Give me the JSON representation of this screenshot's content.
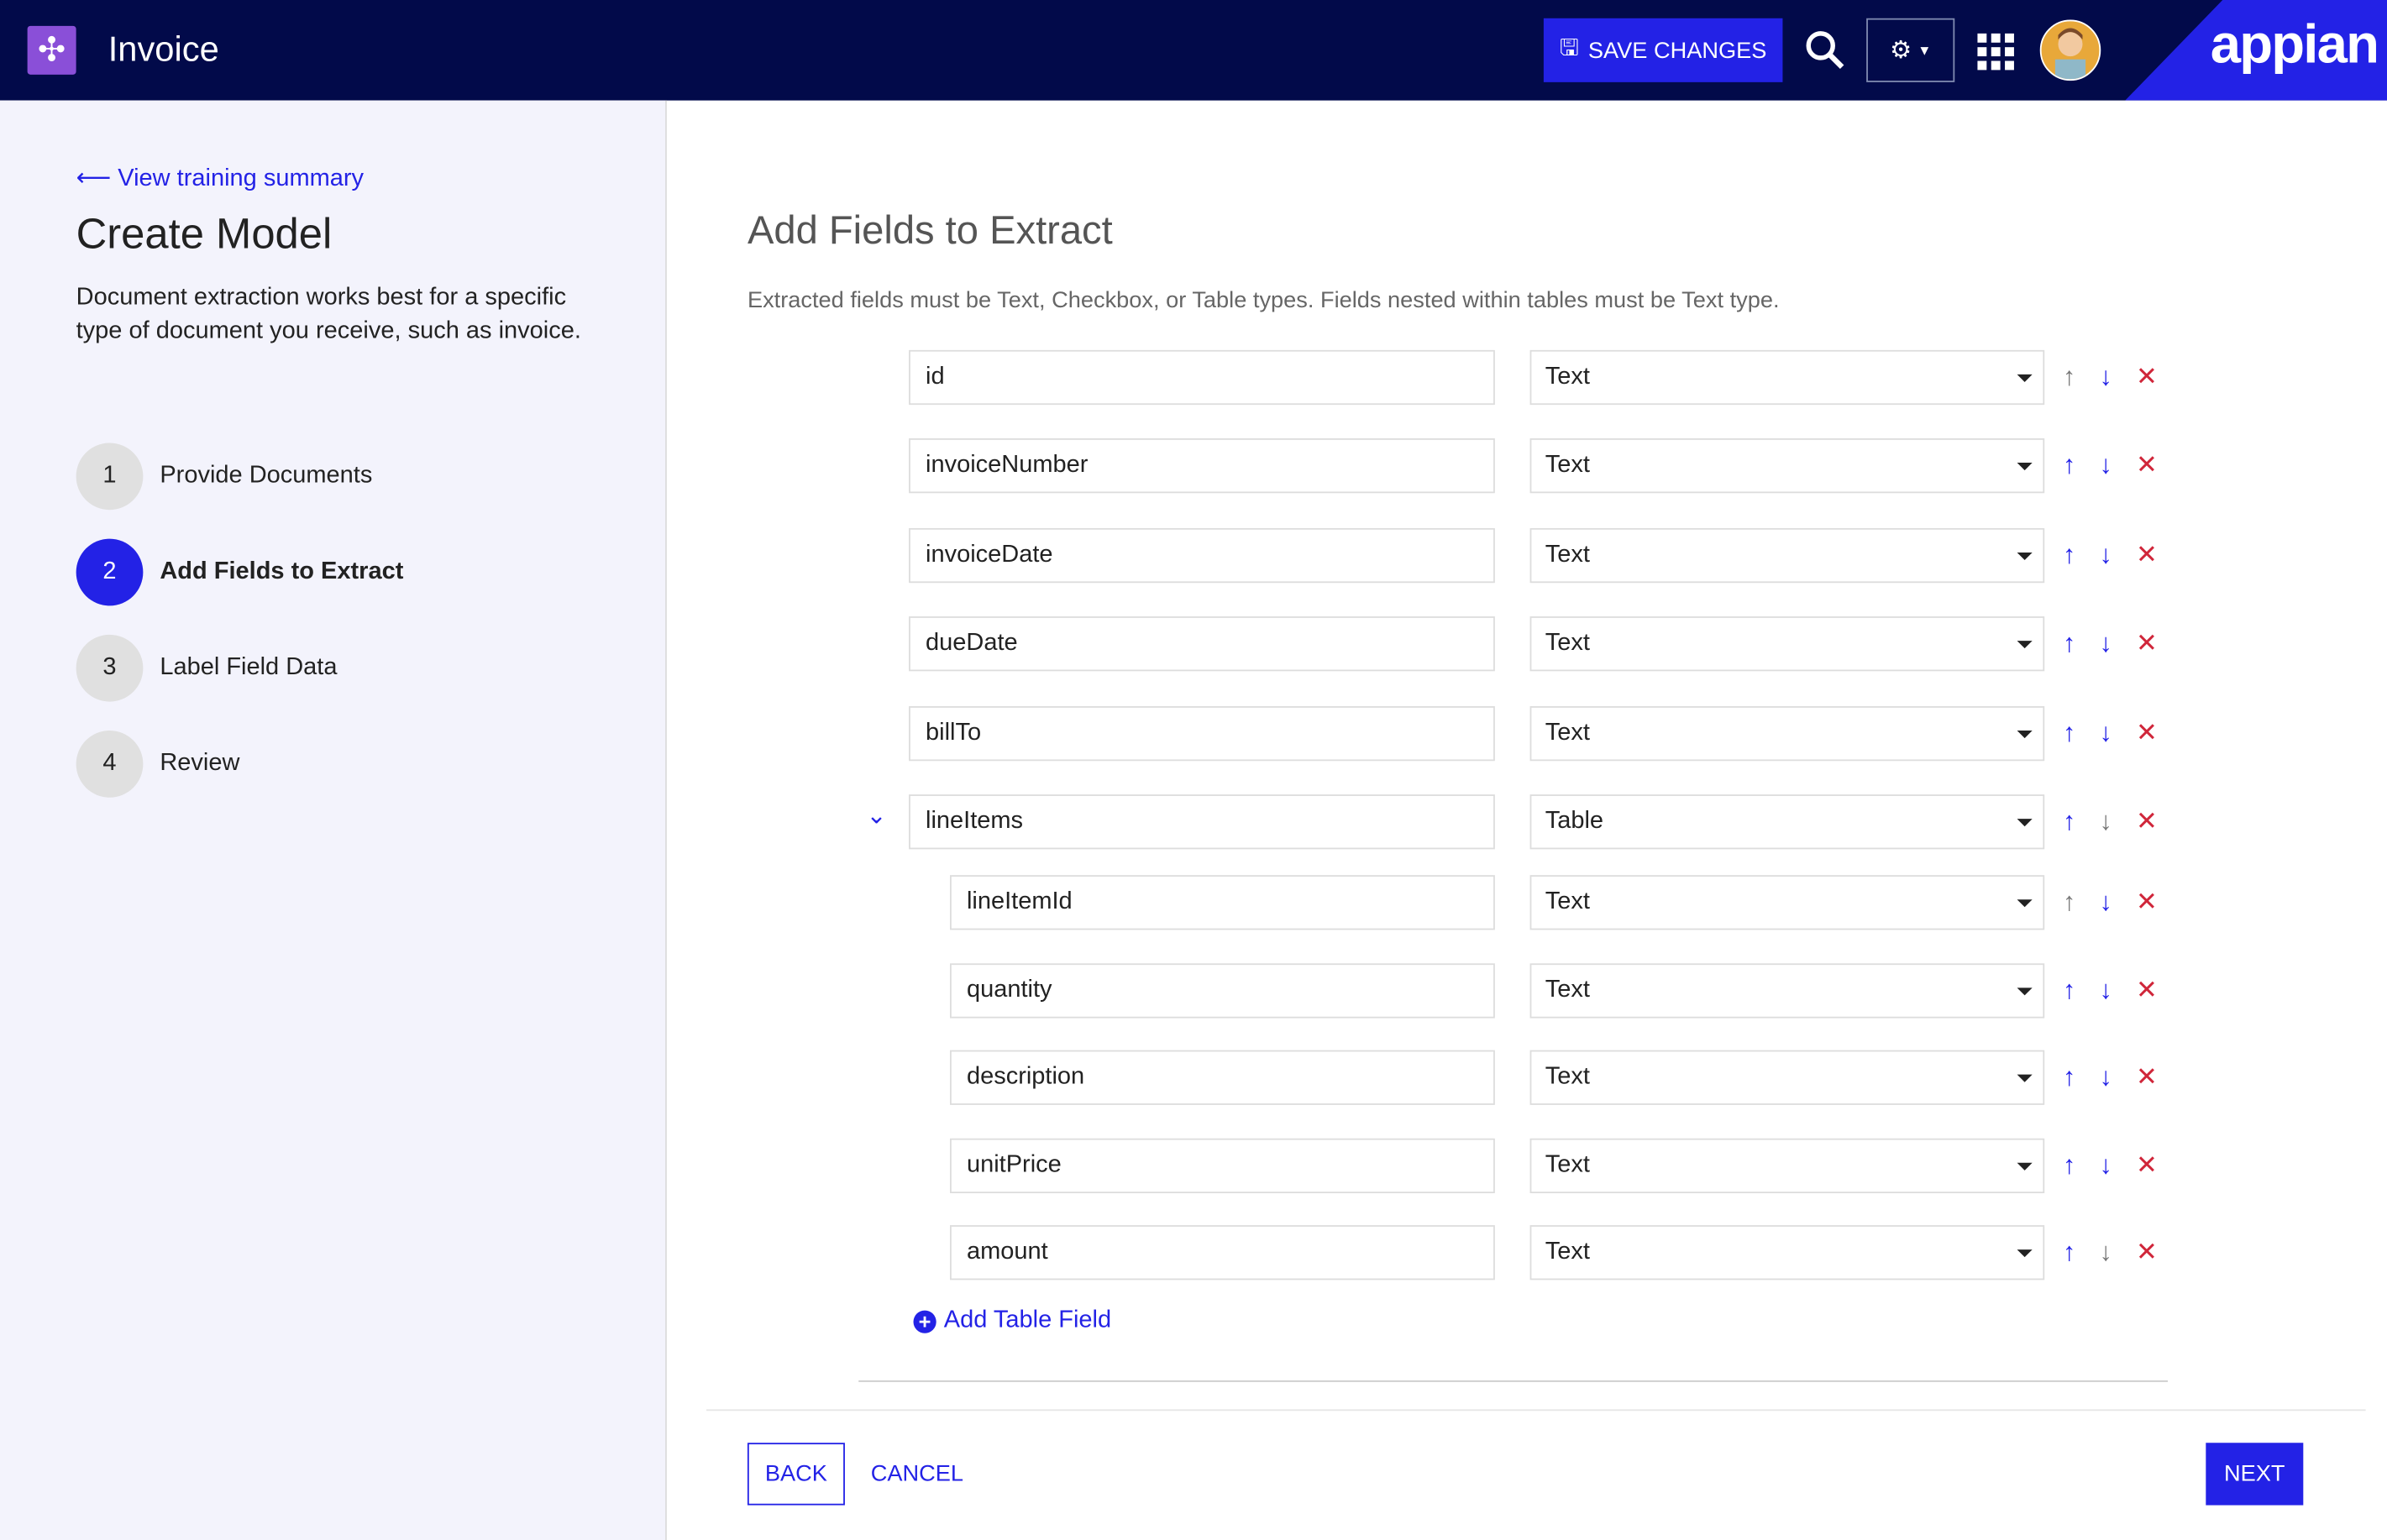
{
  "header": {
    "title": "Invoice",
    "save_label": "SAVE CHANGES",
    "brand": "appian"
  },
  "sidebar": {
    "back_link": "View training summary",
    "title": "Create Model",
    "description": "Document extraction works best for a specific type of document you receive, such as invoice.",
    "steps": [
      {
        "num": "1",
        "label": "Provide Documents",
        "active": false
      },
      {
        "num": "2",
        "label": "Add Fields to Extract",
        "active": true
      },
      {
        "num": "3",
        "label": "Label Field Data",
        "active": false
      },
      {
        "num": "4",
        "label": "Review",
        "active": false
      }
    ]
  },
  "main": {
    "title": "Add Fields to Extract",
    "hint": "Extracted fields must be Text, Checkbox, or Table types. Fields nested within tables must be Text type.",
    "fields": [
      {
        "name": "id",
        "type": "Text",
        "nested": false,
        "up": false,
        "down": true
      },
      {
        "name": "invoiceNumber",
        "type": "Text",
        "nested": false,
        "up": true,
        "down": true
      },
      {
        "name": "invoiceDate",
        "type": "Text",
        "nested": false,
        "up": true,
        "down": true
      },
      {
        "name": "dueDate",
        "type": "Text",
        "nested": false,
        "up": true,
        "down": true
      },
      {
        "name": "billTo",
        "type": "Text",
        "nested": false,
        "up": true,
        "down": true
      },
      {
        "name": "lineItems",
        "type": "Table",
        "nested": false,
        "up": true,
        "down": false,
        "expanded": true
      },
      {
        "name": "lineItemId",
        "type": "Text",
        "nested": true,
        "up": false,
        "down": true
      },
      {
        "name": "quantity",
        "type": "Text",
        "nested": true,
        "up": true,
        "down": true
      },
      {
        "name": "description",
        "type": "Text",
        "nested": true,
        "up": true,
        "down": true
      },
      {
        "name": "unitPrice",
        "type": "Text",
        "nested": true,
        "up": true,
        "down": true
      },
      {
        "name": "amount",
        "type": "Text",
        "nested": true,
        "up": true,
        "down": false
      }
    ],
    "add_table_field": "Add Table Field"
  },
  "footer": {
    "back": "BACK",
    "cancel": "CANCEL",
    "next": "NEXT"
  },
  "colors": {
    "accent": "#2322e6",
    "header": "#020a4a",
    "danger": "#d0263a",
    "disabled": "#777777"
  }
}
